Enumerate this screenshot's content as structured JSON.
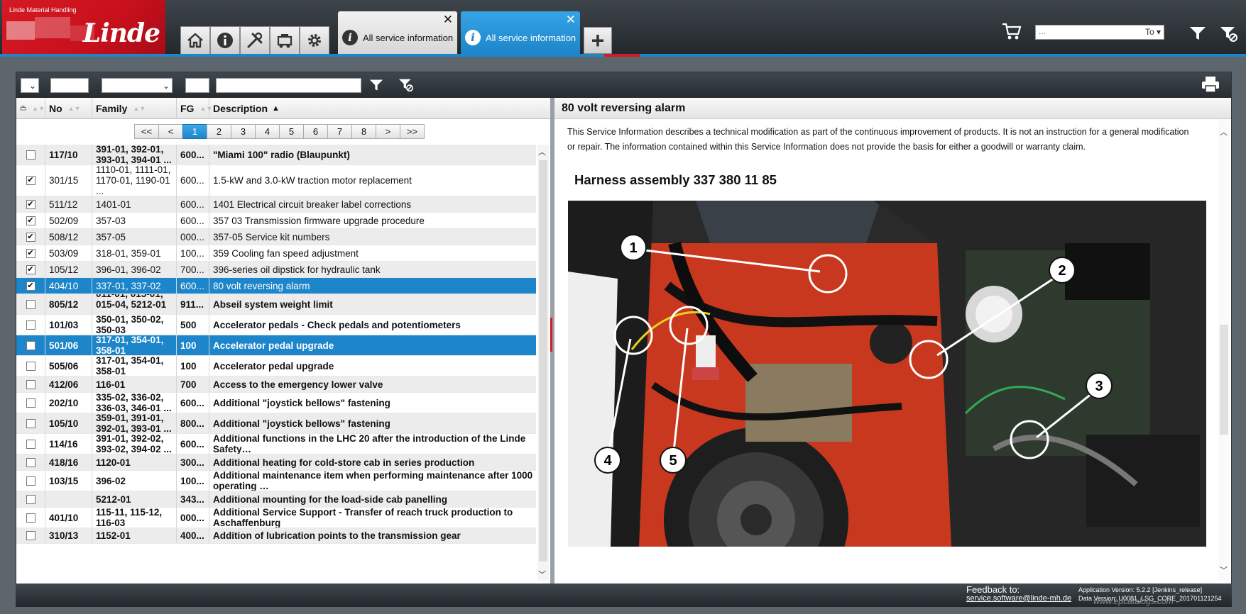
{
  "app": {
    "maker": "Linde Material Handling",
    "brand": "Linde"
  },
  "tabs": [
    {
      "label": "All service information",
      "active": false
    },
    {
      "label": "All service information",
      "active": true
    }
  ],
  "top_search": {
    "placeholder": "...",
    "to_label": "To"
  },
  "colors": {
    "brand_red": "#d41a24",
    "accent_blue": "#1d85c9",
    "chrome_dark": "#262c31"
  },
  "icons": [
    "home-icon",
    "info-icon",
    "tools-icon",
    "machine-icon",
    "gear-icon",
    "cart-icon",
    "filter-icon",
    "filter-clear-icon",
    "printer-icon"
  ],
  "columns": {
    "no": "No",
    "family": "Family",
    "fg": "FG",
    "description": "Description"
  },
  "pager": [
    "<<",
    "<",
    "1",
    "2",
    "3",
    "4",
    "5",
    "6",
    "7",
    "8",
    ">",
    ">>"
  ],
  "pager_active": "1",
  "rows": [
    {
      "checked": false,
      "no": "117/10",
      "family": "391-01, 392-01, 393-01, 394-01 ...",
      "fg": "600...",
      "desc": "\"Miami 100\" radio (Blaupunkt)",
      "bold": true,
      "selected": false
    },
    {
      "checked": true,
      "no": "301/15",
      "family": "1110-01, 1111-01, 1170-01, 1190-01 ...",
      "fg": "600...",
      "desc": "1.5-kW and 3.0-kW traction motor replacement",
      "bold": false,
      "selected": false
    },
    {
      "checked": true,
      "no": "511/12",
      "family": "1401-01",
      "fg": "600...",
      "desc": "1401 Electrical circuit breaker label corrections",
      "bold": false,
      "selected": false
    },
    {
      "checked": true,
      "no": "502/09",
      "family": "357-03",
      "fg": "600...",
      "desc": "357 03 Transmission firmware upgrade procedure",
      "bold": false,
      "selected": false
    },
    {
      "checked": true,
      "no": "508/12",
      "family": "357-05",
      "fg": "000...",
      "desc": "357-05 Service kit numbers",
      "bold": false,
      "selected": false
    },
    {
      "checked": true,
      "no": "503/09",
      "family": "318-01, 359-01",
      "fg": "100...",
      "desc": "359 Cooling fan speed adjustment",
      "bold": false,
      "selected": false
    },
    {
      "checked": true,
      "no": "105/12",
      "family": "396-01, 396-02",
      "fg": "700...",
      "desc": "396-series oil dipstick for hydraulic tank",
      "bold": false,
      "selected": false
    },
    {
      "checked": true,
      "no": "404/10",
      "family": "337-01, 337-02",
      "fg": "600...",
      "desc": "80 volt reversing alarm",
      "bold": false,
      "selected": true
    },
    {
      "checked": false,
      "no": "805/12",
      "family": "011-01, 015-01, 015-04, 5212-01 ...",
      "fg": "911...",
      "desc": "Abseil system weight limit",
      "bold": true,
      "selected": false
    },
    {
      "checked": false,
      "no": "101/03",
      "family": "350-01, 350-02, 350-03",
      "fg": "500",
      "desc": "Accelerator pedals - Check pedals and potentiometers",
      "bold": true,
      "selected": false
    },
    {
      "checked": false,
      "no": "501/06",
      "family": "317-01, 354-01, 358-01",
      "fg": "100",
      "desc": "Accelerator pedal upgrade",
      "bold": true,
      "selected": true
    },
    {
      "checked": false,
      "no": "505/06",
      "family": "317-01, 354-01, 358-01",
      "fg": "100",
      "desc": "Accelerator pedal upgrade",
      "bold": true,
      "selected": false
    },
    {
      "checked": false,
      "no": "412/06",
      "family": "116-01",
      "fg": "700",
      "desc": "Access to the emergency lower valve",
      "bold": true,
      "selected": false
    },
    {
      "checked": false,
      "no": "202/10",
      "family": "335-02, 336-02, 336-03, 346-01 ...",
      "fg": "600...",
      "desc": "Additional \"joystick bellows\" fastening",
      "bold": true,
      "selected": false
    },
    {
      "checked": false,
      "no": "105/10",
      "family": "359-01, 391-01, 392-01, 393-01 ...",
      "fg": "800...",
      "desc": "Additional \"joystick bellows\" fastening",
      "bold": true,
      "selected": false
    },
    {
      "checked": false,
      "no": "114/16",
      "family": "391-01, 392-02, 393-02, 394-02 ...",
      "fg": "600...",
      "desc": "Additional functions in the LHC 20 after the introduction of the Linde Safety…",
      "bold": true,
      "selected": false
    },
    {
      "checked": false,
      "no": "418/16",
      "family": "1120-01",
      "fg": "300...",
      "desc": "Additional heating for cold-store cab in series production",
      "bold": true,
      "selected": false
    },
    {
      "checked": false,
      "no": "103/15",
      "family": "396-02",
      "fg": "100...",
      "desc": "Additional maintenance item when performing maintenance after 1000 operating …",
      "bold": true,
      "selected": false
    },
    {
      "checked": false,
      "no": "",
      "family": "5212-01",
      "fg": "343...",
      "desc": "Additional mounting for the load-side cab panelling",
      "bold": true,
      "selected": false
    },
    {
      "checked": false,
      "no": "401/10",
      "family": "115-11, 115-12, 116-03",
      "fg": "000...",
      "desc": "Additional Service Support - Transfer of reach truck production to Aschaffenburg",
      "bold": true,
      "selected": false
    },
    {
      "checked": false,
      "no": "310/13",
      "family": "1152-01",
      "fg": "400...",
      "desc": "Addition of lubrication points to the transmission gear",
      "bold": true,
      "selected": false
    }
  ],
  "detail": {
    "title": "80 volt reversing alarm",
    "intro": "This Service Information describes a technical modification as part of the continuous improvement of products. It is not an instruction for a general modification or repair. The information contained within this Service Information does not provide the basis for either a goodwill or warranty claim.",
    "heading": "Harness assembly 337 380 11 85",
    "callouts": [
      "1",
      "2",
      "3",
      "4",
      "5"
    ]
  },
  "footer": {
    "feedback_label": "Feedback to:",
    "feedback_email": "service.software@linde-mh.de",
    "app_version": "Application Version: 5.2.2 [Jenkins_release]",
    "data_version": "Data Version: U0081_LSG_CORE_201701121254"
  },
  "watermark": "www.epcatalogs.com"
}
